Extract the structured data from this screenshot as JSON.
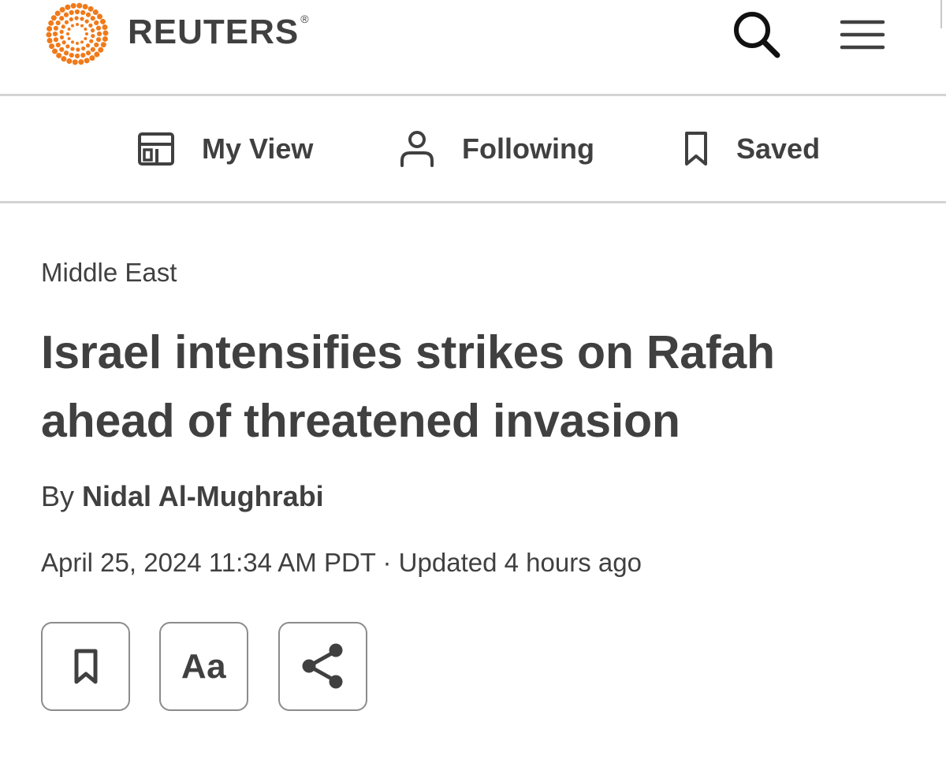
{
  "header": {
    "brand": "REUTERS",
    "registered_mark": "®",
    "brand_color": "#f07a1a",
    "icons": [
      "reuters-logo-icon",
      "search-icon",
      "hamburger-menu-icon"
    ]
  },
  "nav": {
    "items": [
      {
        "label": "My View",
        "icon": "layout-icon"
      },
      {
        "label": "Following",
        "icon": "person-icon"
      },
      {
        "label": "Saved",
        "icon": "bookmark-icon"
      }
    ]
  },
  "article": {
    "section": "Middle East",
    "headline_line1": "Israel intensifies strikes on Rafah",
    "headline_line2": "ahead of threatened invasion",
    "byline_prefix": "By",
    "author": "Nidal Al-Mughrabi",
    "dateline": "April 25, 2024 11:34 AM PDT · Updated 4 hours ago"
  },
  "actions": {
    "bookmark_icon": "bookmark-icon",
    "text_size_label": "Aa",
    "share_icon": "share-icon"
  },
  "colors": {
    "text": "#404040",
    "divider": "#d4d4d4",
    "button_border": "#8c8c8c"
  }
}
